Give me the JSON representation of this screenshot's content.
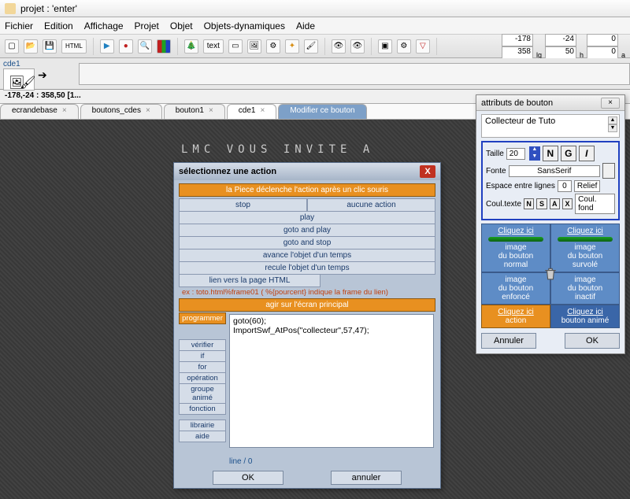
{
  "title": "projet : 'enter'",
  "menu": [
    "Fichier",
    "Edition",
    "Affichage",
    "Projet",
    "Objet",
    "Objets-dynamiques",
    "Aide"
  ],
  "toolbar_text_btn": "text",
  "coords": {
    "a1": "-178",
    "a2": "358",
    "b1": "-24",
    "b2": "50",
    "c1": "0",
    "c2": "0"
  },
  "coord_labels": {
    "a": "lg",
    "b": "h",
    "c": "a"
  },
  "timeline_label": "cde1",
  "status": "-178,-24 : 358,50 [1...",
  "tabs": [
    "ecrandebase",
    "boutons_cdes",
    "bouton1",
    "cde1",
    "Modifier ce bouton"
  ],
  "banner": "LMC   VOUS INVITE A",
  "dlg1": {
    "title": "sélectionnez une action",
    "orange1": "la Piece déclenche l'action après un clic souris",
    "actions_row1": [
      "stop",
      "aucune action"
    ],
    "actions": [
      "play",
      "goto and play",
      "goto and stop",
      "avance l'objet d'un temps",
      "recule l'objet d'un temps"
    ],
    "link_btn": "lien vers la page HTML",
    "hint": "ex : toto.html%frame01  ( %{pourcent} indique la frame du lien)",
    "orange2": "agir sur l'écran principal",
    "side": {
      "programmer": "programmer",
      "verifier": "vérifier",
      "if": "if",
      "for": "for",
      "operation": "opération",
      "groupe": "groupe animé",
      "fonction": "fonction",
      "librairie": "librairie",
      "aide": "aide"
    },
    "code": "goto(60);\nImportSwf_AtPos(\"collecteur\",57,47);",
    "line": "line / 0",
    "ok": "OK",
    "cancel": "annuler"
  },
  "dlg2": {
    "title": "attributs de bouton",
    "name": "Collecteur de Tuto",
    "taille_lbl": "Taille",
    "taille": "20",
    "N": "N",
    "G": "G",
    "I": "I",
    "fonte_lbl": "Fonte",
    "fonte": "SansSerif",
    "espace_lbl": "Espace entre lignes",
    "espace": "0",
    "relief": "Relief",
    "coul_lbl": "Coul.texte",
    "NSAX": [
      "N",
      "S",
      "A",
      "X"
    ],
    "coul_fond": "Coul. fond",
    "cells": {
      "click": "Cliquez ici",
      "normal": "image\ndu bouton\nnormal",
      "survole": "image\ndu bouton\nsurvolé",
      "enfonce": "image\ndu bouton\nenfoncé",
      "inactif": "image\ndu bouton\ninactif",
      "action": "action",
      "anime": "bouton animé"
    },
    "annuler": "Annuler",
    "ok": "OK"
  }
}
